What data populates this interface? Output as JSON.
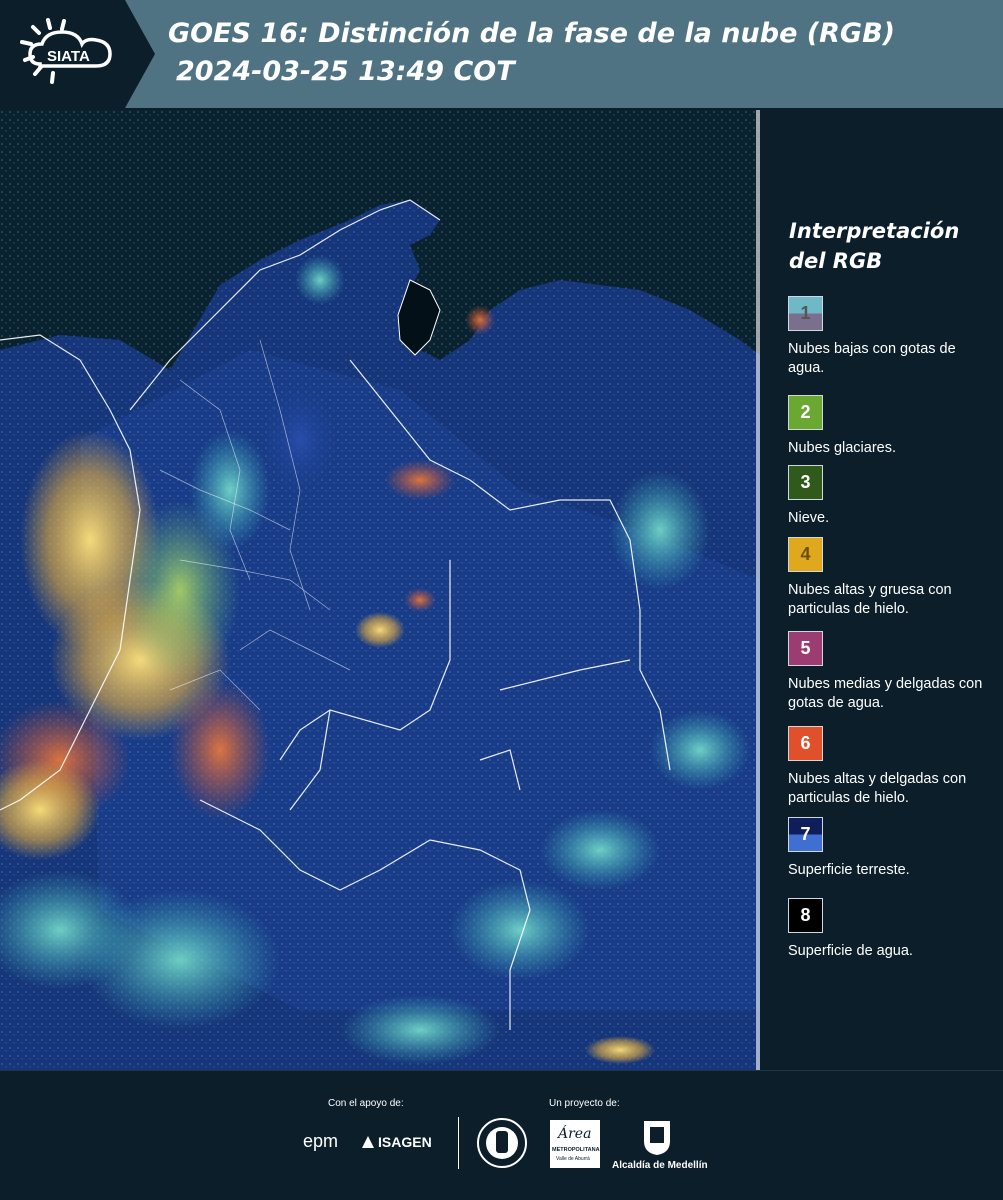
{
  "header": {
    "logo_text": "SIATA",
    "title": "GOES 16: Distinción de la fase de la nube (RGB)",
    "datetime": "2024-03-25 13:49 COT"
  },
  "legend": {
    "title": "Interpretación del RGB",
    "items": [
      {
        "number": "1",
        "label": "Nubes bajas con gotas de agua.",
        "color_top": "#6fb8c8",
        "color_bottom": "#7a6f8c"
      },
      {
        "number": "2",
        "label": "Nubes glaciares.",
        "color_top": "#6aa832",
        "color_bottom": "#6aa832"
      },
      {
        "number": "3",
        "label": "Nieve.",
        "color_top": "#2f5a1c",
        "color_bottom": "#2f5a1c"
      },
      {
        "number": "4",
        "label": "Nubes altas y gruesa con particulas de hielo.",
        "color_top": "#e0a81c",
        "color_bottom": "#e0a81c"
      },
      {
        "number": "5",
        "label": "Nubes medias y delgadas con gotas de agua.",
        "color_top": "#9b3d72",
        "color_bottom": "#9b3d72"
      },
      {
        "number": "6",
        "label": "Nubes altas y delgadas con particulas de hielo.",
        "color_top": "#e0502a",
        "color_bottom": "#e0502a"
      },
      {
        "number": "7",
        "label": "Superficie terreste.",
        "color_top": "#0f1e5a",
        "color_bottom": "#3f6fd0"
      },
      {
        "number": "8",
        "label": "Superficie de agua.",
        "color_top": "#000000",
        "color_bottom": "#000000"
      }
    ]
  },
  "footer": {
    "support_label": "Con el apoyo de:",
    "project_label": "Un proyecto de:",
    "epm": "epm",
    "isagen": "ISAGEN",
    "area_metro": "Área",
    "area_metro_sub": "METROPOLITANA",
    "area_metro_sub2": "Valle de Aburrá",
    "alcaldia": "Alcaldía de Medellín"
  }
}
